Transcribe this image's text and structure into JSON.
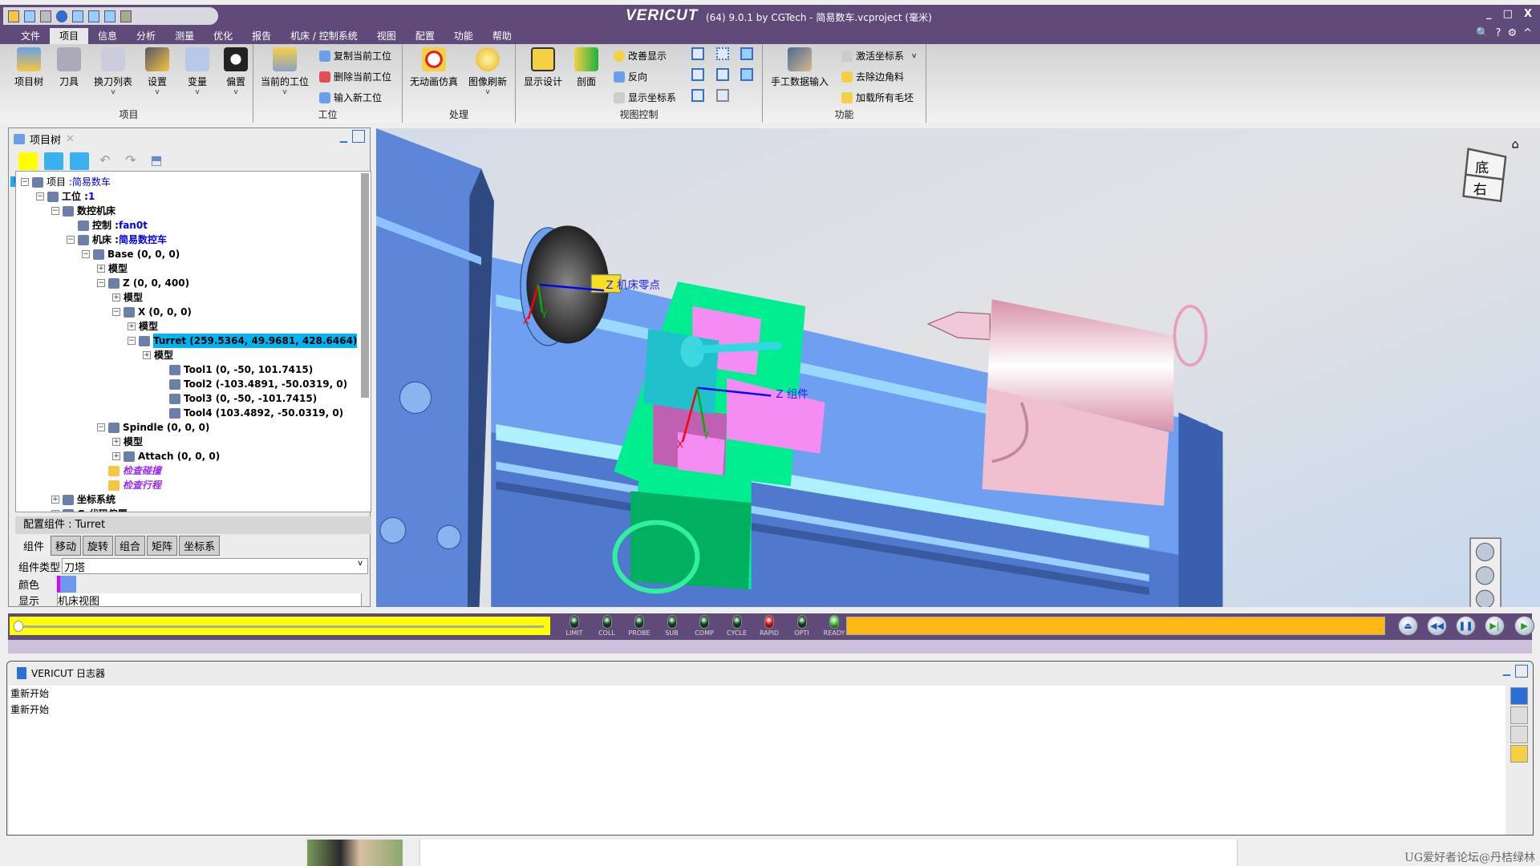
{
  "window": {
    "brand": "VERICUT",
    "title": "(64)  9.0.1 by CGTech - 简易数车.vcproject (毫米)",
    "controls": [
      "_",
      "□",
      "X"
    ]
  },
  "menu": {
    "items": [
      "文件",
      "项目",
      "信息",
      "分析",
      "测量",
      "优化",
      "报告",
      "机床 / 控制系统",
      "视图",
      "配置",
      "功能",
      "帮助"
    ],
    "active": "项目",
    "right_icons": [
      "search-icon",
      "help-icon",
      "gear-icon",
      "collapse-icon"
    ]
  },
  "ribbon": {
    "groups": [
      {
        "label": "项目",
        "buttons": [
          "项目树",
          "刀具",
          "换刀列表",
          "设置",
          "变量",
          "偏置"
        ]
      },
      {
        "label": "工位",
        "big": "当前的工位",
        "small": [
          "复制当前工位",
          "删除当前工位",
          "输入新工位"
        ]
      },
      {
        "label": "处理",
        "buttons": [
          "无动画仿真",
          "图像刷新"
        ]
      },
      {
        "label": "视图控制",
        "buttons": [
          "显示设计",
          "剖面"
        ],
        "small": [
          "改善显示",
          "反向",
          "显示坐标系"
        ]
      },
      {
        "label": "功能",
        "big": "手工数据输入",
        "small": [
          "激活坐标系",
          "去除边角料",
          "加载所有毛坯"
        ]
      }
    ]
  },
  "project_tree": {
    "tab_label": "项目树",
    "rows": [
      {
        "lvl": 0,
        "tog": "-",
        "label": "项目 : ",
        "value": "简易数车",
        "style": "normal"
      },
      {
        "lvl": 1,
        "tog": "-",
        "label": "工位 : ",
        "value": "1",
        "style": "bold"
      },
      {
        "lvl": 2,
        "tog": "-",
        "label": "数控机床",
        "value": "",
        "style": "bold"
      },
      {
        "lvl": 3,
        "tog": "",
        "label": "控制 : ",
        "value": "fan0t",
        "style": "bold"
      },
      {
        "lvl": 3,
        "tog": "-",
        "label": "机床 : ",
        "value": "简易数控车",
        "style": "bold"
      },
      {
        "lvl": 4,
        "tog": "-",
        "label": "Base (0, 0, 0)",
        "value": "",
        "style": "bold"
      },
      {
        "lvl": 5,
        "tog": "+",
        "label": "模型",
        "value": "",
        "style": "bold"
      },
      {
        "lvl": 5,
        "tog": "-",
        "label": "Z (0, 0, 400)",
        "value": "",
        "style": "bold"
      },
      {
        "lvl": 6,
        "tog": "+",
        "label": "模型",
        "value": "",
        "style": "bold"
      },
      {
        "lvl": 6,
        "tog": "-",
        "label": "X (0, 0, 0)",
        "value": "",
        "style": "bold"
      },
      {
        "lvl": 7,
        "tog": "+",
        "label": "模型",
        "value": "",
        "style": "bold"
      },
      {
        "lvl": 7,
        "tog": "-",
        "label": "Turret (259.5364, 49.9681, 428.6464)",
        "value": "",
        "style": "selected"
      },
      {
        "lvl": 8,
        "tog": "+",
        "label": "模型",
        "value": "",
        "style": "bold"
      },
      {
        "lvl": 9,
        "tog": "",
        "label": "Tool1 (0, -50, 101.7415)",
        "value": "",
        "style": "bold"
      },
      {
        "lvl": 9,
        "tog": "",
        "label": "Tool2 (-103.4891, -50.0319, 0)",
        "value": "",
        "style": "bold"
      },
      {
        "lvl": 9,
        "tog": "",
        "label": "Tool3 (0, -50, -101.7415)",
        "value": "",
        "style": "bold"
      },
      {
        "lvl": 9,
        "tog": "",
        "label": "Tool4 (103.4892, -50.0319, 0)",
        "value": "",
        "style": "bold"
      },
      {
        "lvl": 5,
        "tog": "-",
        "label": "Spindle (0, 0, 0)",
        "value": "",
        "style": "bold"
      },
      {
        "lvl": 6,
        "tog": "+",
        "label": "模型",
        "value": "",
        "style": "bold"
      },
      {
        "lvl": 6,
        "tog": "+",
        "label": "Attach (0, 0, 0)",
        "value": "",
        "style": "bold"
      },
      {
        "lvl": 5,
        "tog": "",
        "label": "检查碰撞",
        "value": "",
        "style": "purple"
      },
      {
        "lvl": 5,
        "tog": "",
        "label": "检查行程",
        "value": "",
        "style": "purple"
      },
      {
        "lvl": 2,
        "tog": "+",
        "label": "坐标系统",
        "value": "",
        "style": "bold"
      },
      {
        "lvl": 2,
        "tog": "+",
        "label": "G-代码偏置",
        "value": "",
        "style": "bold"
      }
    ]
  },
  "config": {
    "header": "配置组件 : Turret",
    "tabs": [
      "组件",
      "移动",
      "旋转",
      "组合",
      "矩阵",
      "坐标系"
    ],
    "active_tab": "组件",
    "type_label": "组件类型",
    "type_value": "刀塔",
    "color_label": "颜色",
    "color_value": "#6d98f0",
    "display_label": "显示",
    "display_value": "机床视图"
  },
  "viewport": {
    "labels": {
      "machine_zero": "Z 机床零点",
      "component": "Z 组件",
      "x": "X",
      "y": "Y"
    },
    "navcube": [
      "底",
      "右"
    ]
  },
  "status": {
    "leds": [
      {
        "name": "LIMIT",
        "color": "#0f4a1e"
      },
      {
        "name": "COLL",
        "color": "#0f4a1e"
      },
      {
        "name": "PROBE",
        "color": "#0f4a1e"
      },
      {
        "name": "SUB",
        "color": "#0f4a1e"
      },
      {
        "name": "COMP",
        "color": "#0f4a1e"
      },
      {
        "name": "CYCLE",
        "color": "#0f4a1e"
      },
      {
        "name": "RAPID",
        "color": "#e01010"
      },
      {
        "name": "OPTI",
        "color": "#0f4a1e"
      },
      {
        "name": "READY",
        "color": "#40d030"
      }
    ],
    "slider_position": 0,
    "progress_percent": 0,
    "playback": [
      "eject-icon",
      "rewind-icon",
      "pause-icon",
      "step-icon",
      "play-icon"
    ]
  },
  "log": {
    "tab_label": "VERICUT 日志器",
    "lines": [
      "重新开始",
      "重新开始"
    ]
  },
  "taskbar": {
    "watermark": "UG爱好者论坛@丹桔绿林"
  }
}
